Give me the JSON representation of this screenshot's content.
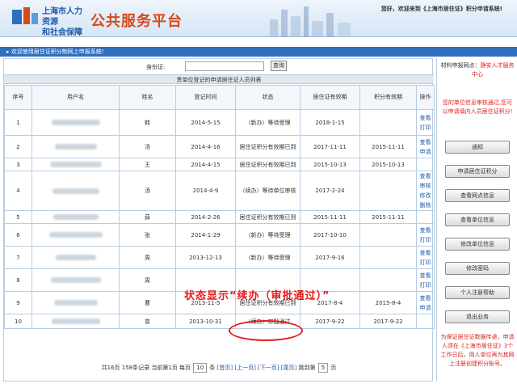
{
  "colors": {
    "brand_blue": "#1f5aa6",
    "brand_orange": "#d8481a",
    "annotation_red": "#e11b1b",
    "link_blue": "#1f5aa6"
  },
  "header": {
    "org_line1": "上海市人力资源",
    "org_line2": "和社会保障",
    "platform": "公共服务平台",
    "welcome": "您好，欢迎来到《上海市居住证》积分申请系统!"
  },
  "welcome_bar": "▸ 欢迎使用居住证积分制网上申报系统!",
  "search": {
    "label": "身份证:",
    "value": "",
    "button": "查询"
  },
  "table": {
    "title": "贵单位登记的申请居住证人员列表",
    "headers": [
      "序号",
      "用户名",
      "姓名",
      "登记时间",
      "状态",
      "居住证有效期",
      "积分有效期",
      "操作"
    ],
    "rows": [
      {
        "no": "1",
        "name": "韩",
        "reg": "2014-5-15",
        "status": "（新办）等待受理",
        "res": "2018-1-15",
        "pts": "",
        "ops": [
          "查看",
          "打印"
        ]
      },
      {
        "no": "2",
        "name": "汤",
        "reg": "2014-4-16",
        "status": "居住证积分有效期已到",
        "res": "2017-11-11",
        "pts": "2015-11-11",
        "ops": [
          "查看",
          "申请"
        ]
      },
      {
        "no": "3",
        "name": "王",
        "reg": "2014-4-15",
        "status": "居住证积分有效期已到",
        "res": "2015-10-13",
        "pts": "2015-10-13",
        "ops": []
      },
      {
        "no": "4",
        "name": "汤",
        "reg": "2014-4-9",
        "status": "（续办）等待单位审核",
        "res": "2017-2-24",
        "pts": "",
        "ops": [
          "查看",
          "审核",
          "修改",
          "删除"
        ]
      },
      {
        "no": "5",
        "name": "薛",
        "reg": "2014-2-26",
        "status": "居住证积分有效期已到",
        "res": "2015-11-11",
        "pts": "2015-11-11",
        "ops": []
      },
      {
        "no": "6",
        "name": "张",
        "reg": "2014-1-29",
        "status": "（新办）等待受理",
        "res": "2017-10-10",
        "pts": "",
        "ops": [
          "查看",
          "打印"
        ]
      },
      {
        "no": "7",
        "name": "周",
        "reg": "2013-12-13",
        "status": "（新办）等待受理",
        "res": "2017-9-16",
        "pts": "",
        "ops": [
          "查看",
          "打印"
        ]
      },
      {
        "no": "8",
        "name": "周",
        "reg": "",
        "status": "",
        "res": "",
        "pts": "",
        "ops": [
          "查看",
          "打印"
        ]
      },
      {
        "no": "9",
        "name": "曹",
        "reg": "2013-11-5",
        "status": "居住证积分有效期已到",
        "res": "2017-8-4",
        "pts": "2015-8-4",
        "ops": [
          "查看",
          "申请"
        ]
      },
      {
        "no": "10",
        "name": "曾",
        "reg": "2013-10-31",
        "status": "（续办）审批通过",
        "res": "2017-9-22",
        "pts": "2017-9-22",
        "ops": []
      }
    ]
  },
  "pager": {
    "summary": "共16页 158条记录 当前第1页 每页",
    "per_page": "10",
    "unit": "条",
    "first": "[首页]",
    "prev": "[上一页]",
    "next": "[下一页]",
    "last": "[尾页]",
    "goto": "跳到第",
    "goto_page": "5",
    "goto_unit": "页"
  },
  "sidebar": {
    "hint_prefix": "材料申报网点：",
    "hint_value": "静安人才服务中心",
    "hint2": "您的单位信息审核通过,您可以申请填内人员居住证积分!",
    "buttons": [
      "通知",
      "申请居住证积分",
      "查看网点信息",
      "查看单位信息",
      "修改单位信息",
      "修改密码",
      "个人注册帮助",
      "退出业务"
    ],
    "hint3": "为保证居住证数据传递，申请人须在《上海市居住证》3个工作日后，用人单位再为其网上注册创建积分账号。"
  },
  "annotation": "状态显示“续办（审批通过）”"
}
